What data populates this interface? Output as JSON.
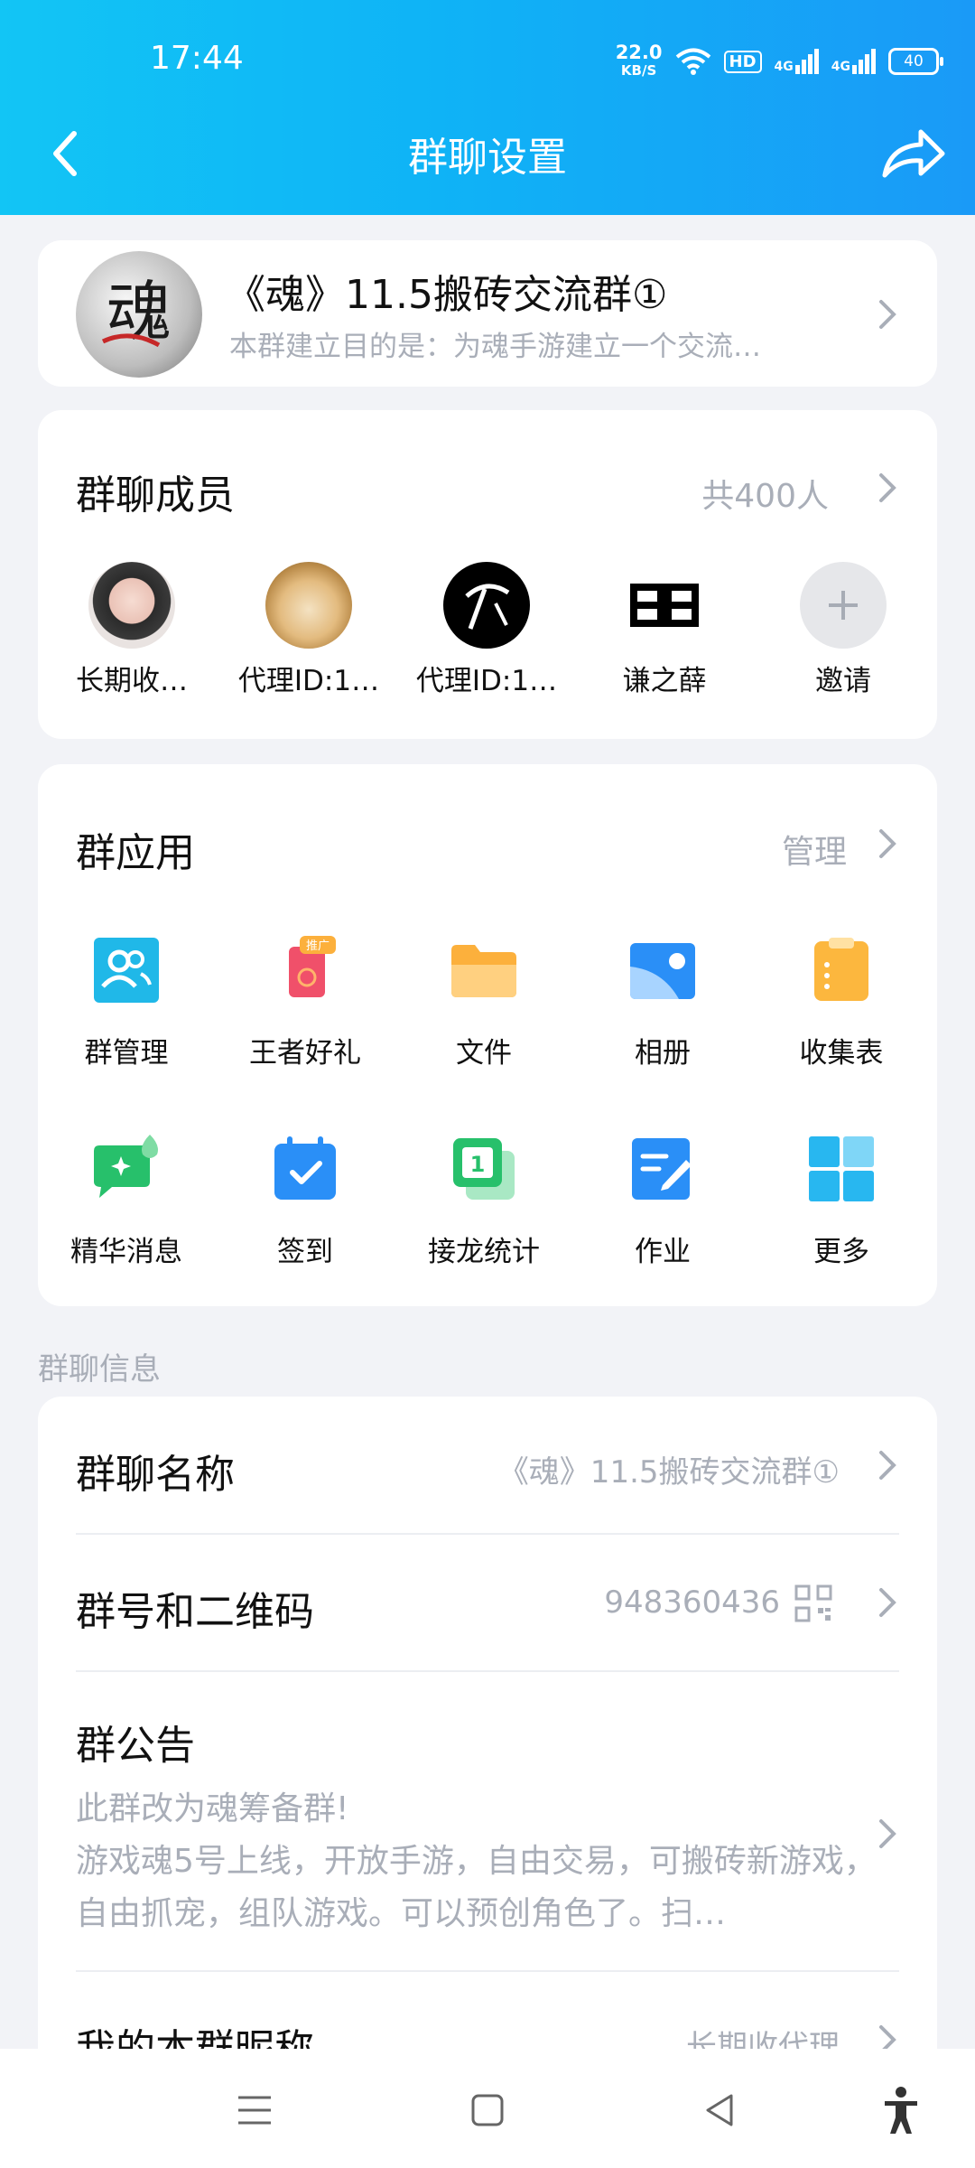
{
  "status": {
    "time": "17:44",
    "net_speed": "22.0",
    "net_unit": "KB/S",
    "hd": "HD",
    "sig1": "4G",
    "sig2": "4G",
    "battery": "40"
  },
  "nav": {
    "title": "群聊设置"
  },
  "group": {
    "name": "《魂》11.5搬砖交流群①",
    "description": "本群建立目的是：为魂手游建立一个交流…",
    "avatar_text": "魂"
  },
  "members": {
    "title": "群聊成员",
    "count": "共400人",
    "list": [
      {
        "name": "长期收…",
        "avatar": "photo-girl"
      },
      {
        "name": "代理ID:1…",
        "avatar": "photo-dog"
      },
      {
        "name": "代理ID:1…",
        "avatar": "logo-black-pickaxe"
      },
      {
        "name": "谦之薛",
        "avatar": "digits-88"
      }
    ],
    "invite": "邀请"
  },
  "apps": {
    "title": "群应用",
    "manage": "管理",
    "items": [
      {
        "label": "群管理",
        "icon": "group-manage-icon",
        "color": "#20b8e8"
      },
      {
        "label": "王者好礼",
        "icon": "gift-icon",
        "color": "#f0506a",
        "badge": "推广"
      },
      {
        "label": "文件",
        "icon": "folder-icon",
        "color": "#fcb03c"
      },
      {
        "label": "相册",
        "icon": "album-icon",
        "color": "#2a8ff7"
      },
      {
        "label": "收集表",
        "icon": "clipboard-icon",
        "color": "#fcb73e"
      },
      {
        "label": "精华消息",
        "icon": "essence-icon",
        "color": "#27c06b"
      },
      {
        "label": "签到",
        "icon": "checkin-icon",
        "color": "#2a8ff7"
      },
      {
        "label": "接龙统计",
        "icon": "relay-icon",
        "color": "#27c06b"
      },
      {
        "label": "作业",
        "icon": "homework-icon",
        "color": "#2a8ff7"
      },
      {
        "label": "更多",
        "icon": "more-grid-icon",
        "color": "#28b7f0"
      }
    ]
  },
  "info": {
    "header": "群聊信息",
    "name_label": "群聊名称",
    "name_value": "《魂》11.5搬砖交流群①",
    "number_label": "群号和二维码",
    "number_value": "948360436",
    "notice_label": "群公告",
    "notice_text": "此群改为魂筹备群!\n游戏魂5号上线，开放手游，自由交易，可搬砖新游戏，自由抓宠，组队游戏。可以预创角色了。扫…",
    "nickname_label": "我的本群昵称",
    "nickname_value": "长期收代理"
  }
}
